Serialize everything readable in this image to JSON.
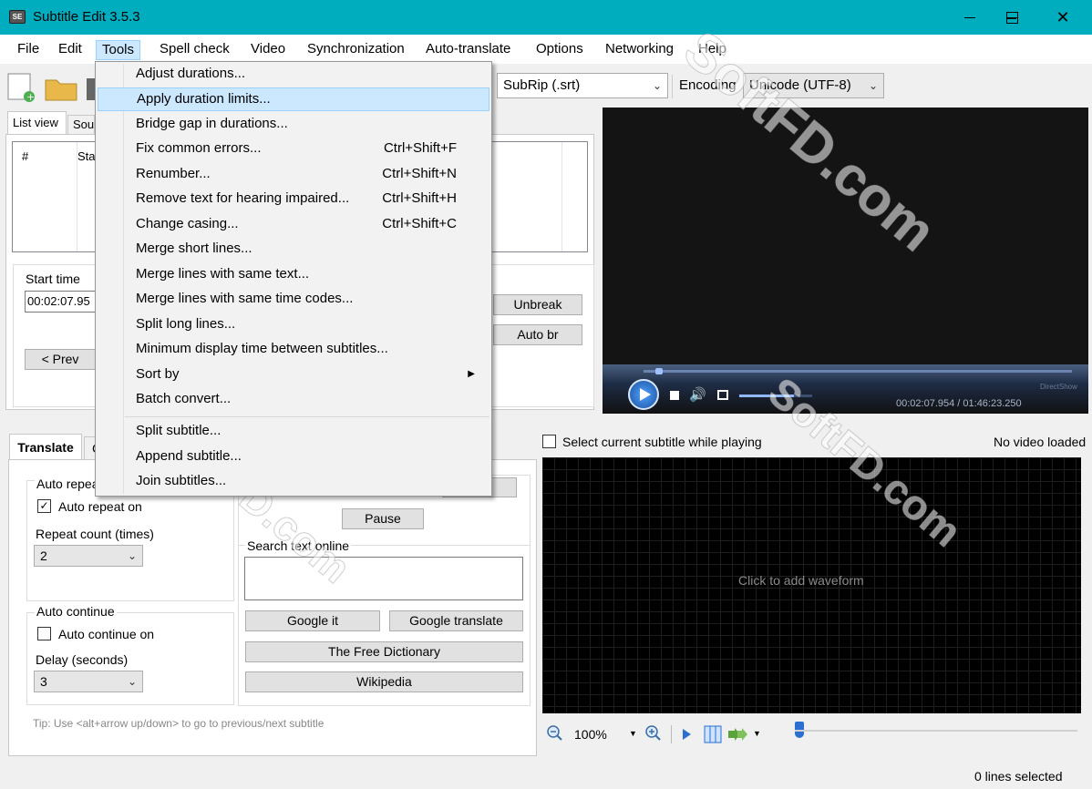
{
  "window": {
    "title": "Subtitle Edit 3.5.3",
    "app_icon_text": "SE"
  },
  "menubar": [
    "File",
    "Edit",
    "Tools",
    "Spell check",
    "Video",
    "Synchronization",
    "Auto-translate",
    "Options",
    "Networking",
    "Help"
  ],
  "toolbar": {
    "format_value": "SubRip (.srt)",
    "encoding_label": "Encoding",
    "encoding_value": "Unicode (UTF-8)"
  },
  "tabs_top": {
    "list_view": "List view",
    "source": "Sou"
  },
  "list": {
    "col_number": "#",
    "col_start": "Sta"
  },
  "edit": {
    "start_time_label": "Start time",
    "start_time_value": "00:02:07.95",
    "prev_button": "< Prev",
    "unbreak_button": "Unbreak",
    "auto_br_button": "Auto br"
  },
  "tools_menu": {
    "items": [
      {
        "label": "Adjust durations...",
        "shortcut": ""
      },
      {
        "label": "Apply duration limits...",
        "shortcut": ""
      },
      {
        "label": "Bridge gap in durations...",
        "shortcut": ""
      },
      {
        "label": "Fix common errors...",
        "shortcut": "Ctrl+Shift+F"
      },
      {
        "label": "Renumber...",
        "shortcut": "Ctrl+Shift+N"
      },
      {
        "label": "Remove text for hearing impaired...",
        "shortcut": "Ctrl+Shift+H"
      },
      {
        "label": "Change casing...",
        "shortcut": "Ctrl+Shift+C"
      },
      {
        "label": "Merge short lines...",
        "shortcut": ""
      },
      {
        "label": "Merge lines with same text...",
        "shortcut": ""
      },
      {
        "label": "Merge lines with same time codes...",
        "shortcut": ""
      },
      {
        "label": "Split long lines...",
        "shortcut": ""
      },
      {
        "label": "Minimum display time between subtitles...",
        "shortcut": ""
      },
      {
        "label": "Sort by",
        "shortcut": ""
      },
      {
        "label": "Batch convert...",
        "shortcut": ""
      },
      {
        "label": "Split subtitle...",
        "shortcut": ""
      },
      {
        "label": "Append subtitle...",
        "shortcut": ""
      },
      {
        "label": "Join subtitles...",
        "shortcut": ""
      }
    ],
    "highlighted_index": 1
  },
  "video": {
    "time_display": "00:02:07.954 / 01:46:23.250",
    "engine": "DirectShow"
  },
  "translate_panel": {
    "tab_translate": "Translate",
    "tab_next": "C",
    "auto_repeat_group": "Auto repea",
    "auto_repeat_on": "Auto repeat on",
    "repeat_count_label": "Repeat count (times)",
    "repeat_count_value": "2",
    "auto_continue_group": "Auto continue",
    "auto_continue_on": "Auto continue on",
    "delay_label": "Delay (seconds)",
    "delay_value": "3",
    "pause_button": "Pause",
    "search_online_label": "Search text online",
    "google_it": "Google it",
    "google_translate": "Google translate",
    "free_dictionary": "The Free Dictionary",
    "wikipedia": "Wikipedia",
    "tip": "Tip: Use <alt+arrow up/down> to go to previous/next subtitle"
  },
  "waveform": {
    "select_current_label": "Select current subtitle while playing",
    "no_video": "No video loaded",
    "click_to_add": "Click to add waveform",
    "zoom_value": "100%"
  },
  "status": {
    "lines_selected": "0 lines selected"
  },
  "watermark": "SoftFD.com"
}
